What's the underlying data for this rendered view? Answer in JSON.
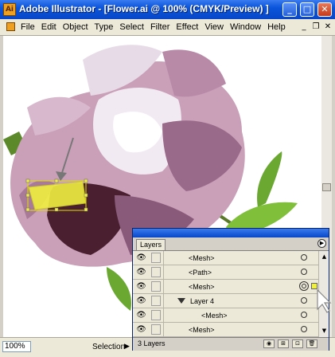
{
  "window": {
    "title": "Adobe Illustrator - [Flower.ai @ 100% (CMYK/Preview) ]",
    "app_icon": "Ai",
    "controls": {
      "minimize": "_",
      "maximize": "□",
      "close": "✕"
    }
  },
  "menubar": {
    "items": [
      "File",
      "Edit",
      "Object",
      "Type",
      "Select",
      "Filter",
      "Effect",
      "View",
      "Window",
      "Help"
    ],
    "doc_controls": {
      "minimize": "_",
      "restore": "❐",
      "close": "✕"
    }
  },
  "status": {
    "zoom": "100%",
    "tool": "Selection",
    "arrow": "▶"
  },
  "layers_panel": {
    "tab": "Layers",
    "menu_glyph": "▶",
    "rows": [
      {
        "label": "<Mesh>",
        "type": "item",
        "eye": "👁",
        "target": "○"
      },
      {
        "label": "<Path>",
        "type": "item",
        "eye": "👁",
        "target": "○"
      },
      {
        "label": "<Mesh>",
        "type": "item",
        "eye": "👁",
        "target": "◎",
        "selected": true
      },
      {
        "label": "Layer 4",
        "type": "layer",
        "eye": "👁",
        "target": "○"
      },
      {
        "label": "<Mesh>",
        "type": "subitem",
        "eye": "👁",
        "target": "○"
      },
      {
        "label": "<Mesh>",
        "type": "item",
        "eye": "👁",
        "target": "○"
      }
    ],
    "layer_count": "3 Layers",
    "scroll": {
      "up": "▲",
      "down": "▼"
    },
    "footer_buttons": [
      "◉",
      "⊞",
      "⊡",
      "🗑"
    ]
  },
  "colors": {
    "title_blue": "#0a55dc",
    "selection_yellow": "#f0f040",
    "petal_pink": "#c9a0b8",
    "leaf_green": "#6aa832"
  }
}
